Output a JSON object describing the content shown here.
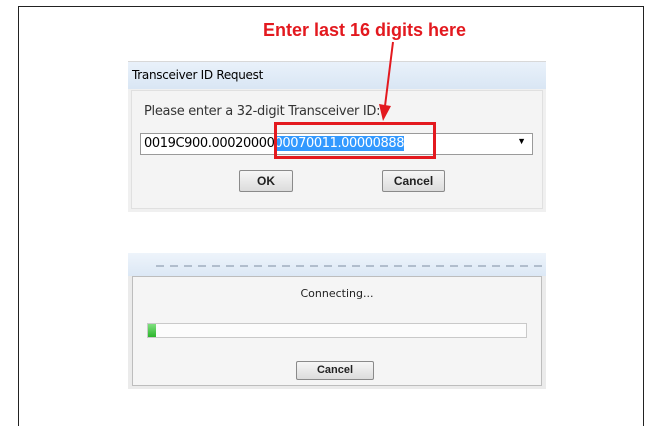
{
  "annotation": {
    "text": "Enter last 16 digits here",
    "color": "#e3191f"
  },
  "transceiver_dialog": {
    "title": "Transceiver ID Request",
    "prompt": "Please enter a 32-digit Transceiver ID:",
    "field_value_prefix": "0019C900.00020000",
    "field_value_selected": "00070011.00000888",
    "ok_label": "OK",
    "cancel_label": "Cancel"
  },
  "connecting_dialog": {
    "status_text": "Connecting...",
    "progress_percent": 2,
    "cancel_label": "Cancel"
  }
}
